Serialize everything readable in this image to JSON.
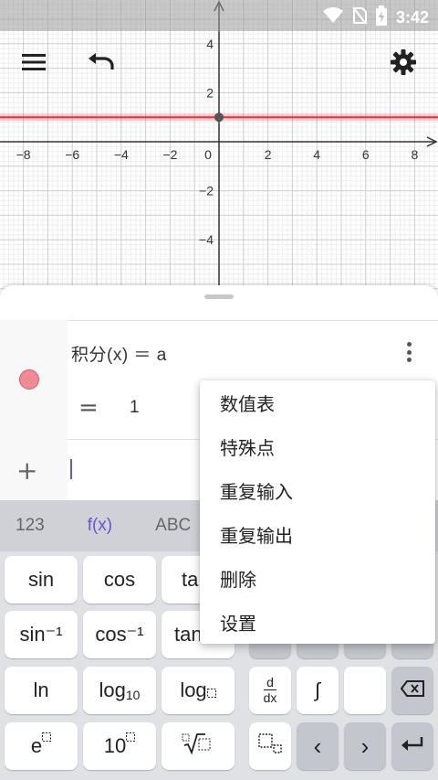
{
  "status_bar": {
    "time": "3:42",
    "icons": [
      "wifi-icon",
      "no-sim-icon",
      "battery-charging-icon"
    ]
  },
  "toolbar": {
    "menu_icon": "hamburger-menu-icon",
    "undo_icon": "undo-icon",
    "settings_icon": "gear-icon"
  },
  "graph": {
    "x_ticks": [
      "−8",
      "−6",
      "−4",
      "−2",
      "0",
      "2",
      "4",
      "6",
      "8"
    ],
    "y_ticks": [
      "4",
      "2",
      "−2",
      "−4"
    ],
    "line_color": "#e8323c",
    "point_color": "#555555"
  },
  "algebra": {
    "expression": "积分(x) ＝ a",
    "equals_sign": "=",
    "value": "1",
    "add_label": "+",
    "item_color": "#f08a96"
  },
  "keyboard": {
    "tabs": [
      "123",
      "f(x)",
      "ABC"
    ],
    "active_tab": "f(x)",
    "accent": "#6557d2",
    "keys": {
      "sin": "sin",
      "cos": "cos",
      "tan_partial": "ta",
      "asin": "sin⁻¹",
      "acos": "cos⁻¹",
      "atan_partial": "tan",
      "ln": "ln",
      "log10_base": "log",
      "log10_sub": "10",
      "logb": "log",
      "exp_base": "e",
      "pow10_base": "10",
      "d_num": "d",
      "d_den": "dx",
      "integral": "∫",
      "left": "‹",
      "right": "›"
    }
  },
  "context_menu": {
    "items": [
      "数值表",
      "特殊点",
      "重复输入",
      "重复输出",
      "删除",
      "设置"
    ]
  }
}
